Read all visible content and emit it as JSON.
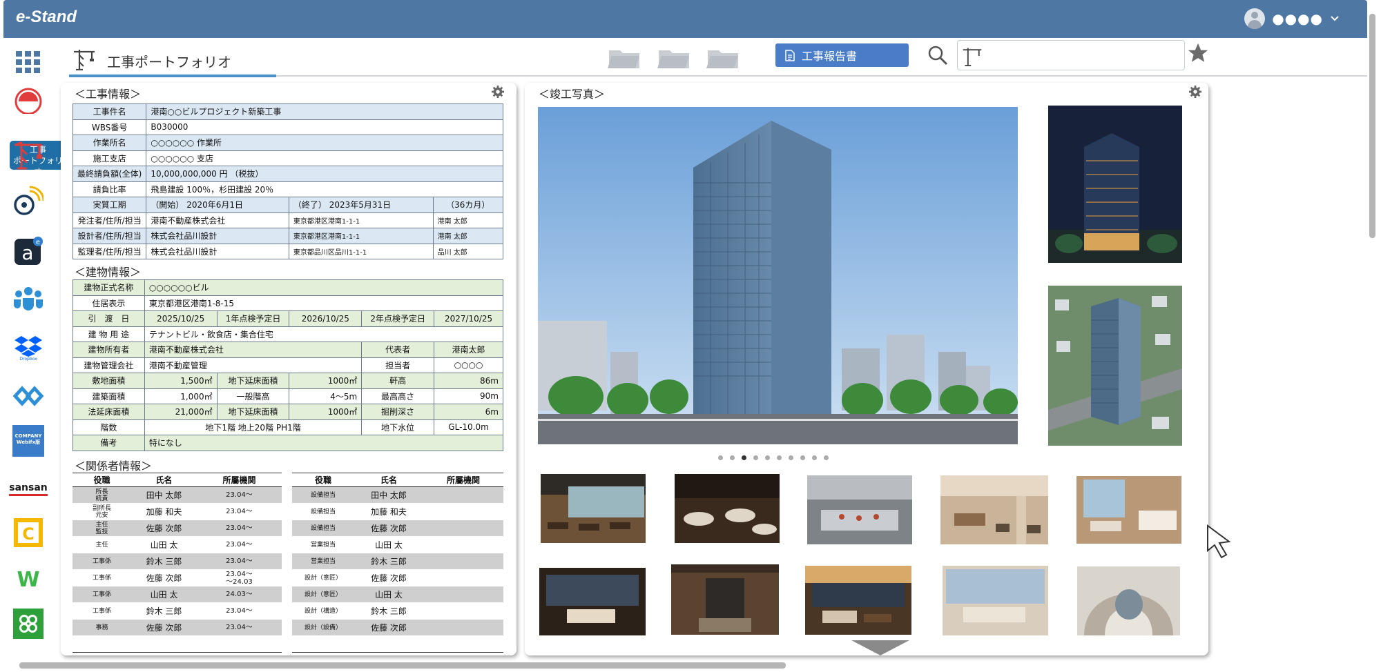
{
  "app": {
    "logo": "e-Stand",
    "user_name": "●●●●"
  },
  "header": {
    "title": "工事ポートフォリオ",
    "report_button": "工事報告書",
    "search_placeholder": ""
  },
  "sidebar": {
    "tooltip_line1": "工事",
    "tooltip_line2": "ポートフォリオ",
    "items": [
      "apps",
      "construction-portfolio",
      "crane",
      "chat",
      "a-app",
      "teams",
      "dropbox",
      "link",
      "company-webiffx",
      "sansan",
      "c-app",
      "w-app",
      "clover"
    ],
    "company_label": "COMPANY Webifx版",
    "sansan_label": "sansan",
    "dropbox_label": "Dropbox"
  },
  "construction": {
    "section_title": "＜工事情報＞",
    "rows": [
      {
        "label": "工事件名",
        "value": "港南○○ビルプロジェクト新築工事"
      },
      {
        "label": "WBS番号",
        "value": "B030000"
      },
      {
        "label": "作業所名",
        "value": "○○○○○○ 作業所"
      },
      {
        "label": "施工支店",
        "value": "○○○○○○ 支店"
      },
      {
        "label": "最終請負額(全体)",
        "value": "10,000,000,000 円 （税抜）"
      },
      {
        "label": "請負比率",
        "value": "飛島建設 100％，杉田建設 20％"
      }
    ],
    "period": {
      "label": "実質工期",
      "start": "（開始） 2020年6月1日",
      "end": "（終了） 2023年5月31日",
      "months": "（36カ月）"
    },
    "parties": [
      {
        "label": "発注者/住所/担当",
        "company": "港南不動産株式会社",
        "address": "東京都港区港南1-1-1",
        "person": "港南 太郎"
      },
      {
        "label": "設計者/住所/担当",
        "company": "株式会社品川設計",
        "address": "東京都港区港南1-1-1",
        "person": "港南 太郎"
      },
      {
        "label": "監理者/住所/担当",
        "company": "株式会社品川設計",
        "address": "東京都品川区品川1-1-1",
        "person": "品川 太郎"
      }
    ]
  },
  "building": {
    "section_title": "＜建物情報＞",
    "official_name_label": "建物正式名称",
    "official_name": "○○○○○○ビル",
    "address_label": "住居表示",
    "address": "東京都港区港南1-8-15",
    "handover_label": "引　渡　日",
    "handover": "2025/10/25",
    "insp1_label": "1年点検予定日",
    "insp1": "2026/10/25",
    "insp2_label": "2年点検予定日",
    "insp2": "2027/10/25",
    "use_label": "建 物 用 途",
    "use": "テナントビル・飲食店・集合住宅",
    "owner_label": "建物所有者",
    "owner": "港南不動産株式会社",
    "rep_label": "代表者",
    "rep": "港南太郎",
    "mgmt_label": "建物管理会社",
    "mgmt": "港南不動産管理",
    "staff_label": "担当者",
    "staff": "○○○○",
    "site_area_label": "敷地面積",
    "site_area": "1,500㎡",
    "basement_area_label": "地下延床面積",
    "basement_area": "1000㎡",
    "eaves_label": "軒高",
    "eaves": "86m",
    "build_area_label": "建築面積",
    "build_area": "1,000㎡",
    "floor_height_label": "一般階高",
    "floor_height": "4～5m",
    "max_height_label": "最高高さ",
    "max_height": "90m",
    "legal_area_label": "法延床面積",
    "legal_area": "21,000㎡",
    "basement_area2_label": "地下延床面積",
    "basement_area2": "1000㎡",
    "excavation_label": "掘削深さ",
    "excavation": "6m",
    "floors_label": "階数",
    "floors": "地下1階 地上20階 PH1階",
    "groundwater_label": "地下水位",
    "groundwater": "GL-10.0m",
    "remarks_label": "備考",
    "remarks": "特になし"
  },
  "people": {
    "section_title": "＜関係者情報＞",
    "headers": [
      "役職",
      "氏名",
      "所屬機関"
    ],
    "left": [
      {
        "role": "所長\n統責",
        "name": "田中 太郎",
        "date": "23.04～",
        "gray": true
      },
      {
        "role": "副所長\n元安",
        "name": "加藤 和夫",
        "date": "23.04～",
        "gray": false
      },
      {
        "role": "主任\n監技",
        "name": "佐藤 次郎",
        "date": "23.04～",
        "gray": true
      },
      {
        "role": "主任",
        "name": "山田 太",
        "date": "23.04～",
        "gray": false
      },
      {
        "role": "工事係",
        "name": "鈴木 三郎",
        "date": "23.04～",
        "gray": true
      },
      {
        "role": "工事係",
        "name": "佐藤 次郎",
        "date": "23.04～\n～24.03",
        "gray": false
      },
      {
        "role": "工事係",
        "name": "山田 太",
        "date": "24.03～",
        "gray": true
      },
      {
        "role": "工事係",
        "name": "鈴木 三郎",
        "date": "23.04～",
        "gray": false
      },
      {
        "role": "事務",
        "name": "佐藤 次郎",
        "date": "23.04～",
        "gray": true
      }
    ],
    "right": [
      {
        "role": "設備担当",
        "name": "田中 太郎",
        "gray": true
      },
      {
        "role": "設備担当",
        "name": "加藤 和夫",
        "gray": false
      },
      {
        "role": "設備担当",
        "name": "佐藤 次郎",
        "gray": true
      },
      {
        "role": "営業担当",
        "name": "山田 太",
        "gray": false
      },
      {
        "role": "営業担当",
        "name": "鈴木 三郎",
        "gray": true
      },
      {
        "role": "設計（意匠）",
        "name": "佐藤 次郎",
        "gray": false
      },
      {
        "role": "設計（意匠）",
        "name": "山田 太",
        "gray": true
      },
      {
        "role": "設計（構造）",
        "name": "鈴木 三郎",
        "gray": false
      },
      {
        "role": "設計（設備）",
        "name": "佐藤 次郎",
        "gray": true
      }
    ]
  },
  "photos": {
    "section_title": "＜竣工写真＞",
    "dot_count": 10,
    "active_dot": 2
  },
  "colors": {
    "topbar": "#4e77a3",
    "accent": "#4a90c8",
    "button": "#4a7dc8",
    "blue_row": "#dbe8f4",
    "green_row": "#e3efd9"
  }
}
